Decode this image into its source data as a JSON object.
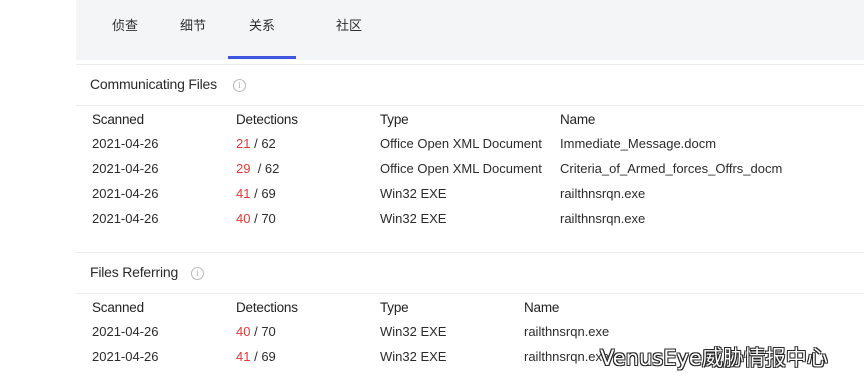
{
  "tabs": [
    "侦查",
    "细节",
    "关系",
    "社区"
  ],
  "active_tab": 2,
  "communicating_files": {
    "title": "Communicating Files",
    "columns": [
      "Scanned",
      "Detections",
      "Type",
      "Name"
    ],
    "rows": [
      {
        "scanned": "2021-04-26",
        "detected": "21",
        "total": "/ 62",
        "type": "Office Open XML Document",
        "name": "Immediate_Message.docm"
      },
      {
        "scanned": "2021-04-26",
        "detected": "29",
        "total": "/ 62",
        "type": "Office Open XML Document",
        "name": "Criteria_of_Armed_forces_Offrs_docm"
      },
      {
        "scanned": "2021-04-26",
        "detected": "41",
        "total": "/ 69",
        "type": "Win32 EXE",
        "name": "railthnsrqn.exe"
      },
      {
        "scanned": "2021-04-26",
        "detected": "40",
        "total": "/ 70",
        "type": "Win32 EXE",
        "name": "railthnsrqn.exe"
      }
    ]
  },
  "files_referring": {
    "title": "Files Referring",
    "columns": [
      "Scanned",
      "Detections",
      "Type",
      "Name"
    ],
    "rows": [
      {
        "scanned": "2021-04-26",
        "detected": "40",
        "total": "/ 70",
        "type": "Win32 EXE",
        "name": "railthnsrqn.exe"
      },
      {
        "scanned": "2021-04-26",
        "detected": "41",
        "total": "/ 69",
        "type": "Win32 EXE",
        "name": "railthnsrqn.exe"
      }
    ]
  },
  "info_icon_glyph": "i",
  "watermark": "VenusEye威胁情报中心",
  "colors": {
    "detection_highlight": "#e53935",
    "active_tab_underline": "#3d56e0",
    "tab_band": "#f4f5f7"
  }
}
